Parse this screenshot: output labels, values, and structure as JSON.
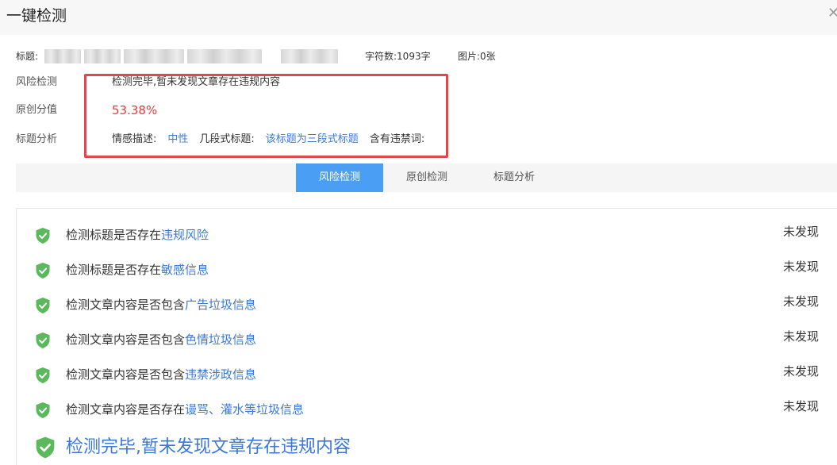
{
  "dialog": {
    "title": "一键检测",
    "close_icon": "close-icon"
  },
  "meta": {
    "title_label": "标题:",
    "char_count": "字符数:1093字",
    "image_count": "图片:0张"
  },
  "info": {
    "risk_label": "风险检测",
    "risk_value": "检测完毕,暂未发现文章存在违规内容",
    "original_label": "原创分值",
    "original_value": "53.38%",
    "title_label": "标题分析",
    "sentiment_label": "情感描述:",
    "sentiment_value": "中性",
    "segment_label": "几段式标题:",
    "segment_value": "该标题为三段式标题",
    "banned_label": "含有违禁词:"
  },
  "tabs": [
    {
      "label": "风险检测",
      "active": true
    },
    {
      "label": "原创检测",
      "active": false
    },
    {
      "label": "标题分析",
      "active": false
    }
  ],
  "checks": [
    {
      "prefix": "检测标题是否存在",
      "keyword": "违规风险",
      "status": "未发现"
    },
    {
      "prefix": "检测标题是否存在",
      "keyword": "敏感信息",
      "status": "未发现"
    },
    {
      "prefix": "检测文章内容是否包含",
      "keyword": "广告垃圾信息",
      "status": "未发现"
    },
    {
      "prefix": "检测文章内容是否包含",
      "keyword": "色情垃圾信息",
      "status": "未发现"
    },
    {
      "prefix": "检测文章内容是否包含",
      "keyword": "违禁涉政信息",
      "status": "未发现"
    },
    {
      "prefix": "检测文章内容是否存在",
      "keyword": "谩骂、灌水等垃圾信息",
      "status": "未发现"
    }
  ],
  "summary": {
    "text": "检测完毕,暂未发现文章存在违规内容"
  },
  "colors": {
    "accent": "#4a9ff5",
    "link": "#3b78d8",
    "score": "#e4393c",
    "shield": "#5cb85c",
    "highlight": "#e0484b"
  }
}
